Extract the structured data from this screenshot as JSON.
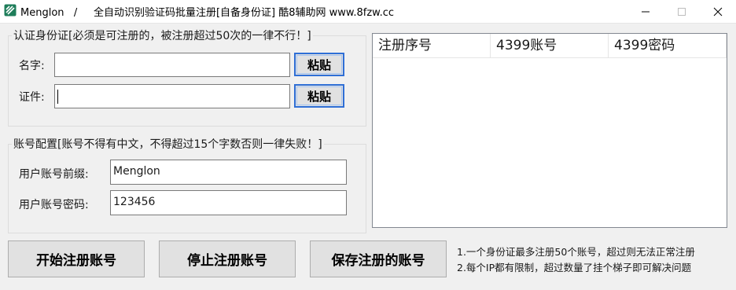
{
  "window": {
    "app_name": "Menglon",
    "separator": "/",
    "subtitle": "全自动识别验证码批量注册[自备身份证] 酷8辅助网 www.8fzw.cc",
    "controls": {
      "minimize": "—",
      "maximize": "☐",
      "close": "✕"
    }
  },
  "identity_group": {
    "legend": "认证身份证[必须是可注册的，被注册超过50次的一律不行！]",
    "name_label": "名字:",
    "name_value": "",
    "id_label": "证件:",
    "id_value": "",
    "paste_label": "粘贴"
  },
  "account_group": {
    "legend": "账号配置[账号不得有中文，不得超过15个字数否则一律失败！]",
    "prefix_label": "用户账号前缀:",
    "prefix_value": "Menglon",
    "password_label": "用户账号密码:",
    "password_value": "123456"
  },
  "results_table": {
    "columns": [
      "注册序号",
      "4399账号",
      "4399密码"
    ],
    "rows": []
  },
  "actions": {
    "start_label": "开始注册账号",
    "stop_label": "停止注册账号",
    "save_label": "保存注册的账号"
  },
  "notes": [
    "1.一个身份证最多注册50个账号，超过则无法正常注册",
    "2.每个IP都有限制，超过数量了挂个梯子即可解决问题"
  ],
  "colors": {
    "background": "#f0f0f0",
    "focus_border": "#2f6fd6",
    "app_icon": "#1e7d5a"
  }
}
